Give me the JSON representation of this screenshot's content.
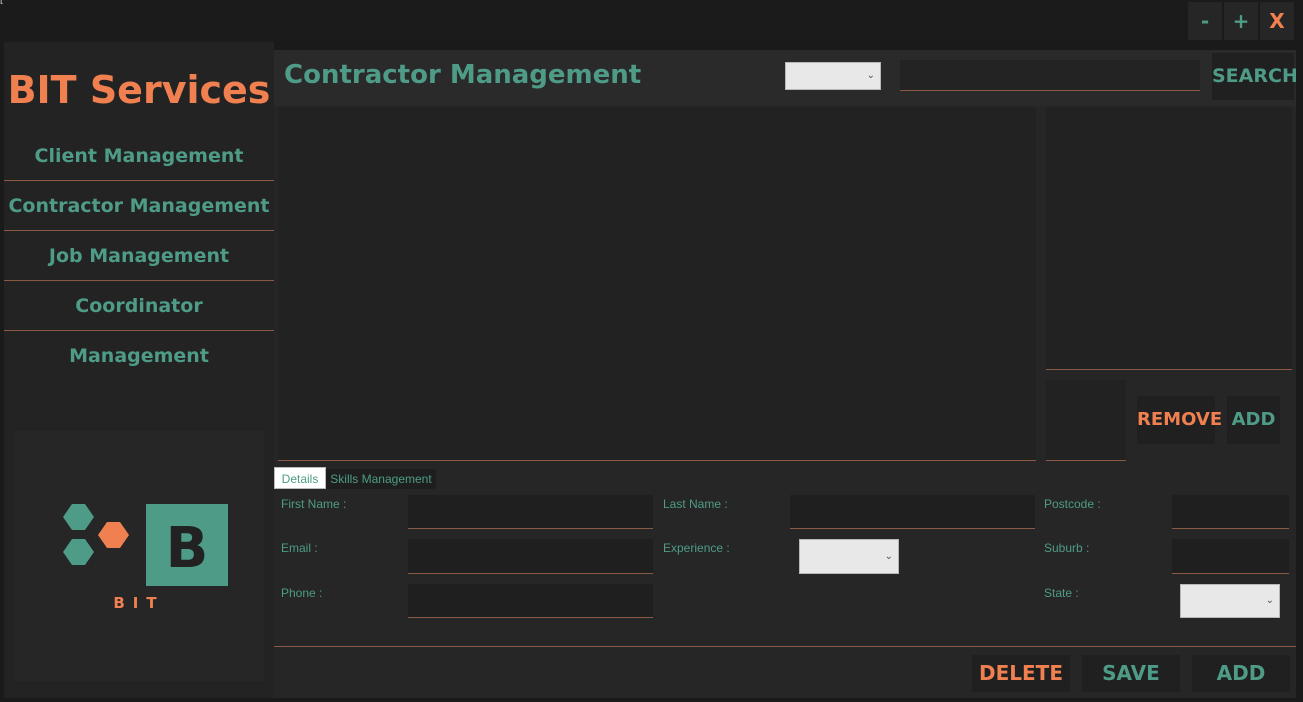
{
  "window": {
    "corner_label": "[",
    "minimize_label": "-",
    "maximize_label": "+",
    "close_label": "X"
  },
  "sidebar": {
    "brand": "BIT Services",
    "items": [
      {
        "label": "Client Management"
      },
      {
        "label": "Contractor Management"
      },
      {
        "label": "Job Management"
      },
      {
        "label": "Coordinator Management"
      }
    ],
    "logo_letter": "B",
    "logo_text": "BIT"
  },
  "header": {
    "title": "Contractor Management",
    "filter_value": "",
    "search_value": "",
    "search_label": "SEARCH"
  },
  "skills": {
    "remove_label": "REMOVE",
    "add_label": "ADD"
  },
  "tabs": [
    {
      "label": "Details",
      "active": true
    },
    {
      "label": "Skills Management",
      "active": false
    }
  ],
  "form": {
    "first_name": {
      "label": "First Name :",
      "value": ""
    },
    "last_name": {
      "label": "Last Name :",
      "value": ""
    },
    "postcode": {
      "label": "Postcode :",
      "value": ""
    },
    "email": {
      "label": "Email :",
      "value": ""
    },
    "experience": {
      "label": "Experience :",
      "value": ""
    },
    "suburb": {
      "label": "Suburb :",
      "value": ""
    },
    "phone": {
      "label": "Phone :",
      "value": ""
    },
    "state": {
      "label": "State :",
      "value": ""
    }
  },
  "actions": {
    "delete_label": "DELETE",
    "save_label": "SAVE",
    "add_label": "ADD"
  },
  "colors": {
    "accent_teal": "#4e9c87",
    "accent_orange": "#f08050",
    "background": "#1a1a1a"
  }
}
